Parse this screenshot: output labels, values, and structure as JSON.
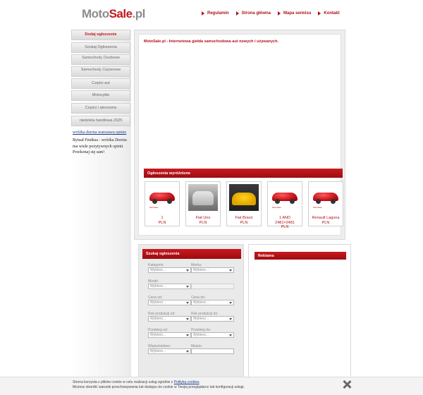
{
  "logo": {
    "moto": "Moto",
    "sale": "Sale",
    "tld": ".pl"
  },
  "topnav": [
    {
      "label": "Regulamin"
    },
    {
      "label": "Strona główna"
    },
    {
      "label": "Mapa serwisu"
    },
    {
      "label": "Kontakt"
    }
  ],
  "sidebar": {
    "menu": [
      {
        "label": "Dodaj ogłoszenie"
      },
      {
        "label": "Szukaj Ogłoszenia"
      },
      {
        "label": "Samochody Osobowe"
      },
      {
        "label": "Samochody Ciężarowe"
      },
      {
        "label": "Części aut"
      },
      {
        "label": "Motocykle"
      },
      {
        "label": "Części i akcesoria"
      },
      {
        "label": "niedziela handlowa 2025"
      }
    ],
    "link": "wróżka dorota warszawa opinie",
    "text": "Rytuał Feniksa - wróżka Dorota ma wiele pozytywnych opinii. Przekonaj się sam!"
  },
  "main": {
    "intro": "MotoSale.pl - Internetowa giełda samochodowa aut nowych i używanych.",
    "featured_title": "Ogłoszenia wyróżnione",
    "cards": [
      {
        "title": "1",
        "price": "PLN"
      },
      {
        "title": "Fiat Uno",
        "price": "PLN"
      },
      {
        "title": "Fiat Bravo",
        "price": "PLN"
      },
      {
        "title": "1 AND 2481=2481",
        "price": "PLN"
      },
      {
        "title": "Renault Laguna",
        "price": "PLN"
      }
    ]
  },
  "search": {
    "title": "Szukaj ogłoszenia",
    "placeholder_select": "Wybierz...",
    "kategoria": "Kategorie:",
    "marka": "Marka:",
    "model": "Model:",
    "cena_od": "Cena od:",
    "cena_do": "Cena do:",
    "rok_od": "Rok produkcji od:",
    "rok_do": "Rok produkcji do:",
    "przebieg_od": "Przebieg od:",
    "przebieg_do": "Przebieg do:",
    "wojewodztwo": "Województwo:",
    "miasto": "Miasto:"
  },
  "ad": {
    "title": "Reklama"
  },
  "cookie": {
    "line1_pre": "Strona korzysta z plików cookie w celu realizacji usług zgodnie z ",
    "link": "Polityką cookies",
    "line1_post": ".",
    "line2": "Możesz określić warunki przechowywania lub dostępu do cookie w Twojej przeglądarce lub konfiguracji usługi."
  }
}
